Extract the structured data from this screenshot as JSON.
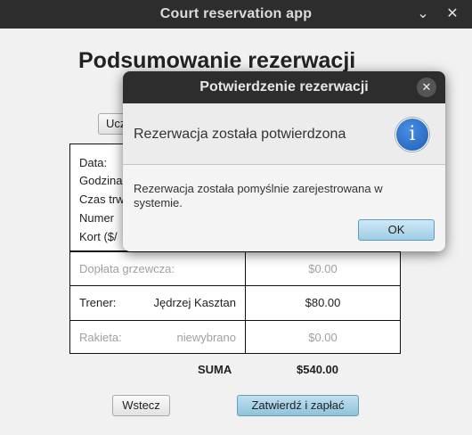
{
  "window": {
    "title": "Court reservation app",
    "minimize_glyph": "⌄",
    "close_glyph": "✕"
  },
  "page": {
    "title": "Podsumowanie rezerwacji",
    "partial_button_label": "Ucz"
  },
  "summary": {
    "labels": [
      "Data:",
      "Godzina",
      "Czas trw",
      "Numer",
      "Kort ($/"
    ],
    "rows": [
      {
        "label": "Dopłata grzewcza:",
        "detail": "",
        "price": "$0.00",
        "muted": true
      },
      {
        "label": "Trener:",
        "detail": "Jędrzej Kasztan",
        "price": "$80.00",
        "muted": false
      },
      {
        "label": "Rakieta:",
        "detail": "niewybrano",
        "price": "$0.00",
        "muted": true
      }
    ],
    "total_label": "SUMA",
    "total_value": "$540.00"
  },
  "buttons": {
    "back": "Wstecz",
    "confirm": "Zatwierdź i zapłać"
  },
  "dialog": {
    "title": "Potwierdzenie rezerwacji",
    "close_glyph": "✕",
    "header": "Rezerwacja została potwierdzona",
    "icon_glyph": "i",
    "content": "Rezerwacja została pomyślnie zarejestrowana w systemie.",
    "ok": "OK"
  },
  "colors": {
    "titlebar": "#2d2d2d",
    "accent_button": "#8fc3dc",
    "info_icon": "#1f5fb8"
  }
}
